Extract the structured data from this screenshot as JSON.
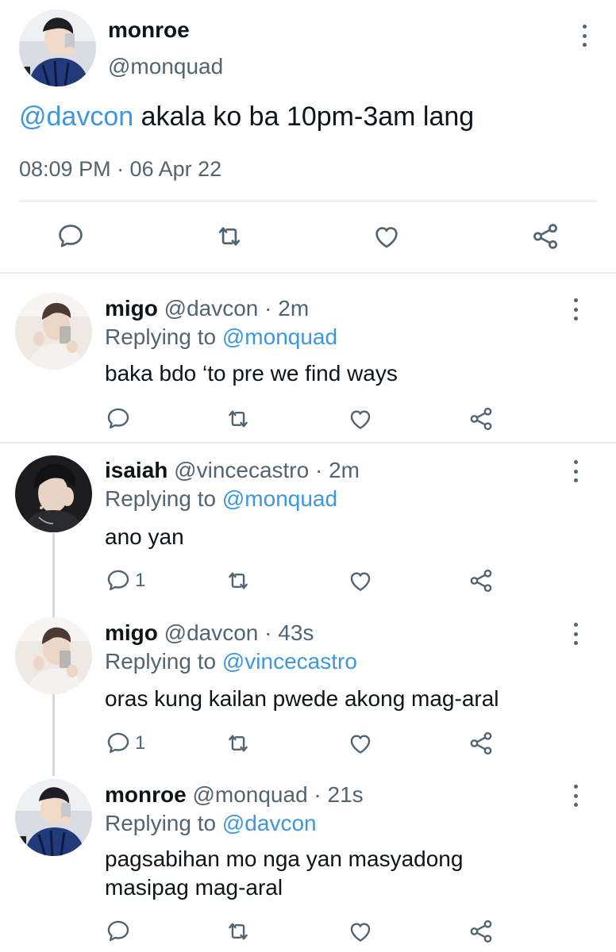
{
  "main_tweet": {
    "author_name": "monroe",
    "author_handle": "@monquad",
    "text_mention": "@davcon",
    "text_body": " akala ko ba 10pm-3am lang",
    "timestamp": "08:09 PM · 06 Apr 22",
    "icons": [
      "comment-icon",
      "retweet-icon",
      "like-icon",
      "share-icon",
      "more-icon"
    ]
  },
  "replies": [
    {
      "name": "migo",
      "meta": " @davcon · 2m",
      "replying_label": "Replying to ",
      "replying_to": "@monquad",
      "text": "baka bdo ‘to pre we find ways",
      "reply_count": ""
    },
    {
      "name": "isaiah",
      "meta": " @vincecastro · 2m",
      "replying_label": "Replying to ",
      "replying_to": "@monquad",
      "text": "ano yan",
      "reply_count": "1"
    },
    {
      "name": "migo",
      "meta": " @davcon · 43s",
      "replying_label": "Replying to ",
      "replying_to": "@vincecastro",
      "text": "oras kung kailan pwede akong mag-aral",
      "reply_count": "1"
    },
    {
      "name": "monroe",
      "meta": " @monquad · 21s",
      "replying_label": "Replying to ",
      "replying_to": "@davcon",
      "text_line1": "pagsabihan mo nga yan masyadong",
      "text_line2": "masipag mag-aral",
      "reply_count": ""
    }
  ],
  "colors": {
    "mention": "#3d97e0",
    "muted": "#536471",
    "text": "#0f1419",
    "divider": "#e8ebed"
  }
}
